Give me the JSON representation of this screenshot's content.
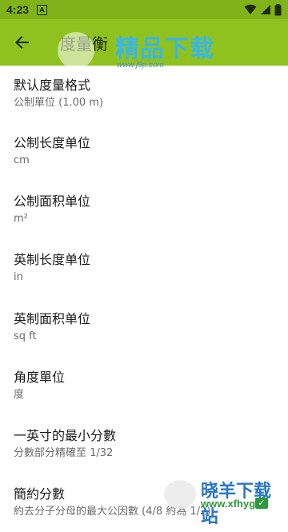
{
  "status_bar": {
    "time": "4:23",
    "notification_glyph": "A",
    "icons": [
      "wifi-icon",
      "signal-icon",
      "battery-icon"
    ]
  },
  "app_bar": {
    "title": "度量衡",
    "back_icon": "arrow-back-icon"
  },
  "settings": [
    {
      "title": "默认度量格式",
      "summary": "公制單位 (1.00 m)"
    },
    {
      "title": "公制长度单位",
      "summary": "cm"
    },
    {
      "title": "公制面积单位",
      "summary": "m²"
    },
    {
      "title": "英制长度单位",
      "summary": "in"
    },
    {
      "title": "英制面积单位",
      "summary": "sq ft"
    },
    {
      "title": "角度單位",
      "summary": "度"
    },
    {
      "title": "一英寸的最小分數",
      "summary": "分數部分精確至 1/32"
    },
    {
      "title": "簡約分數",
      "summary": "約去分子分母的最大公因數 (4/8 約為 1/2)"
    }
  ],
  "watermarks": {
    "top_text": "精品下载",
    "top_url": "www.j9p.com",
    "bottom_text": "晓羊下载站",
    "bottom_url": "www.xfhyg"
  },
  "colors": {
    "status_bar": "#7fb319",
    "app_bar": "#8fc21e"
  }
}
